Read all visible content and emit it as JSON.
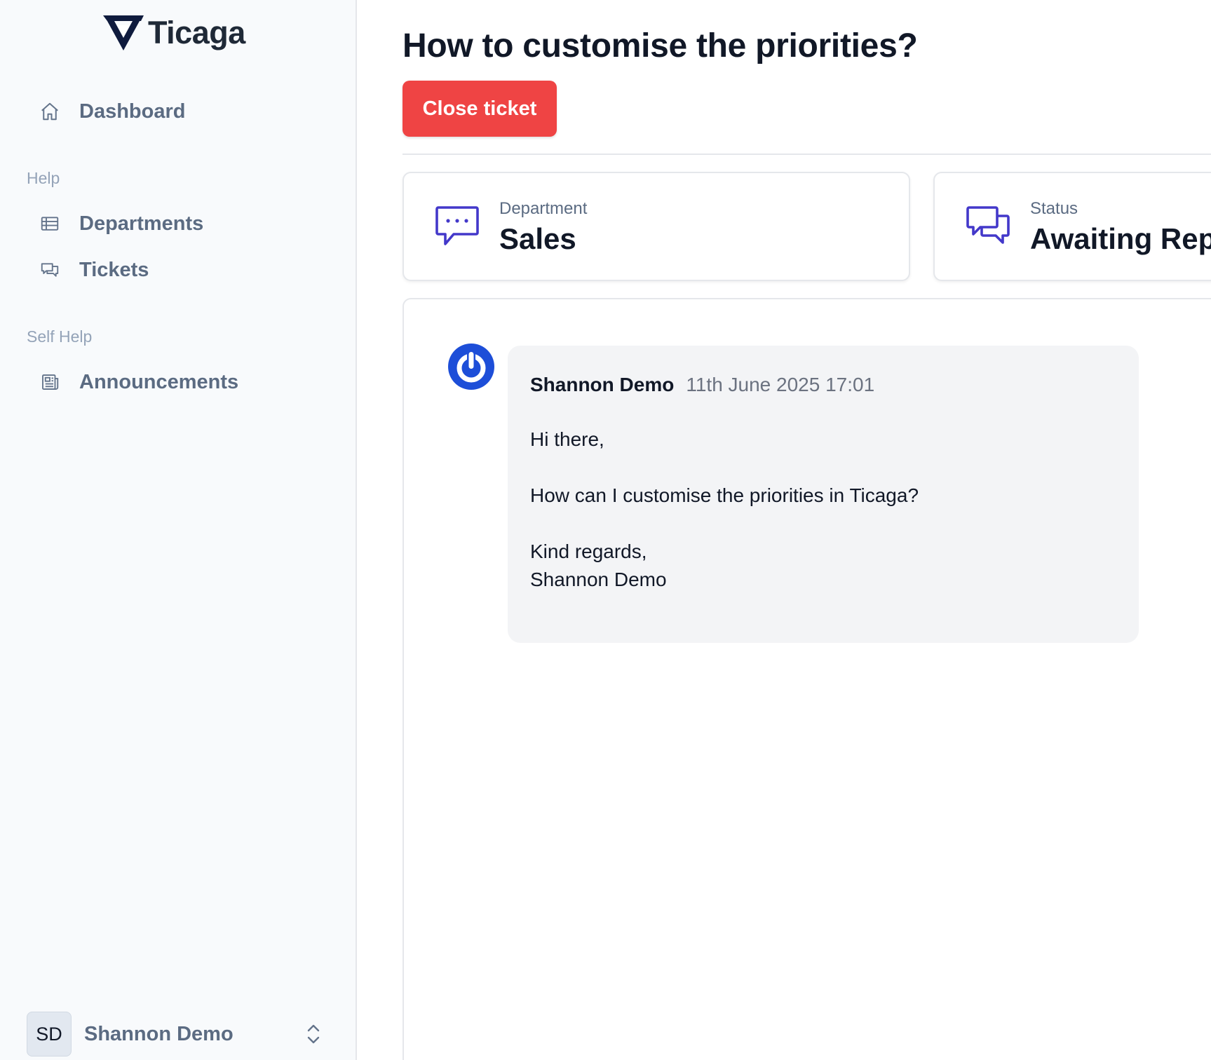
{
  "brand": {
    "name": "Ticaga"
  },
  "sidebar": {
    "items": [
      {
        "label": "Dashboard",
        "icon": "home-icon"
      },
      {
        "label": "Departments",
        "icon": "table-icon"
      },
      {
        "label": "Tickets",
        "icon": "chat-bubbles-icon"
      },
      {
        "label": "Announcements",
        "icon": "newspaper-icon"
      }
    ],
    "sections": {
      "help": "Help",
      "self_help": "Self Help"
    },
    "user": {
      "initials": "SD",
      "name": "Shannon Demo",
      "icon": "chevron-up-down-icon"
    }
  },
  "ticket": {
    "title": "How to customise the priorities?",
    "close_label": "Close ticket",
    "department": {
      "label": "Department",
      "value": "Sales",
      "icon": "chat-dots-icon"
    },
    "status": {
      "label": "Status",
      "value": "Awaiting Reply",
      "icon": "chat-bubbles-icon"
    }
  },
  "messages": [
    {
      "author": "Shannon Demo",
      "time": "11th June 2025 17:01",
      "lines": [
        "Hi there,",
        "How can I customise the priorities in Ticaga?",
        "Kind regards,",
        "Shannon Demo"
      ]
    }
  ],
  "colors": {
    "accent": "#4338ca",
    "danger": "#ef4444",
    "avatar_blue": "#1d4ed8",
    "sidebar_bg": "#f8fafc"
  }
}
